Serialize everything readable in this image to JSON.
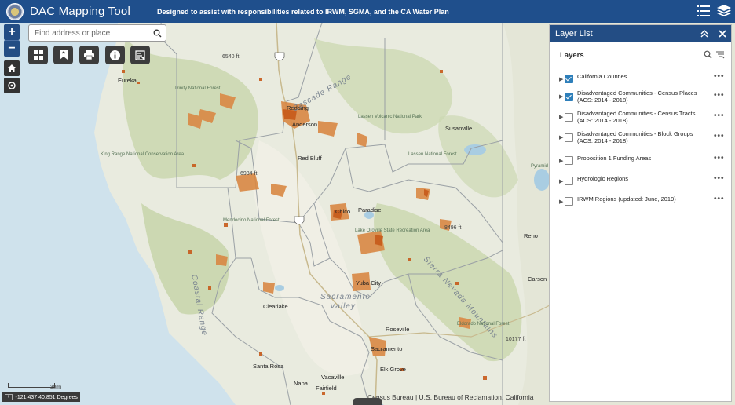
{
  "header": {
    "title": "DAC Mapping Tool",
    "subtitle": "Designed to assist with responsibilities related to IRWM, SGMA, and the CA Water Plan",
    "icons": [
      "seal-logo",
      "layer-list-icon",
      "layers-icon"
    ]
  },
  "search": {
    "placeholder": "Find address or place"
  },
  "zoom": {
    "in": "+",
    "out": "−"
  },
  "toolbar": [
    "basemap-gallery-icon",
    "bookmark-icon",
    "print-icon",
    "info-icon",
    "legend-icon"
  ],
  "layer_panel": {
    "title": "Layer List",
    "section_label": "Layers",
    "layers": [
      {
        "name": "California Counties",
        "checked": true
      },
      {
        "name": "Disadvantaged Communities - Census Places (ACS: 2014 - 2018)",
        "checked": true
      },
      {
        "name": "Disadvantaged Communities - Census Tracts (ACS: 2014 - 2018)",
        "checked": false
      },
      {
        "name": "Disadvantaged Communities - Block Groups (ACS: 2014 - 2018)",
        "checked": false
      },
      {
        "name": "Proposition 1 Funding Areas",
        "checked": false
      },
      {
        "name": "Hydrologic Regions",
        "checked": false
      },
      {
        "name": "IRWM Regions (updated: June, 2019)",
        "checked": false
      }
    ]
  },
  "map_labels": {
    "cities": [
      "Eureka",
      "Redding",
      "Anderson",
      "Red Bluff",
      "Susanville",
      "Chico",
      "Paradise",
      "Yuba City",
      "Clearlake",
      "Roseville",
      "Sacramento",
      "Elk Grove",
      "Santa Rosa",
      "Vacaville",
      "Fairfield",
      "Napa",
      "Reno",
      "Carson"
    ],
    "regions": [
      "Cascade Range",
      "Sacramento",
      "Valley",
      "Coastal Range",
      "Sierra Nevada Mountains"
    ],
    "parks": [
      "Trinity National Forest",
      "Lassen Volcanic National Park",
      "King Range National Conservation Area",
      "Mendocino National Forest",
      "Lake Oroville State Recreation Area",
      "Lassen National Forest",
      "Eldorado National Forest",
      "Pyramid Lake"
    ],
    "elevations": [
      "6540 ft",
      "6984 ft",
      "8496 ft",
      "10177 ft"
    ]
  },
  "coordinates": "-121.437 40.851 Degrees",
  "scale": "30mi",
  "attribution": "Census Bureau | U.S. Bureau of Reclamation, California"
}
